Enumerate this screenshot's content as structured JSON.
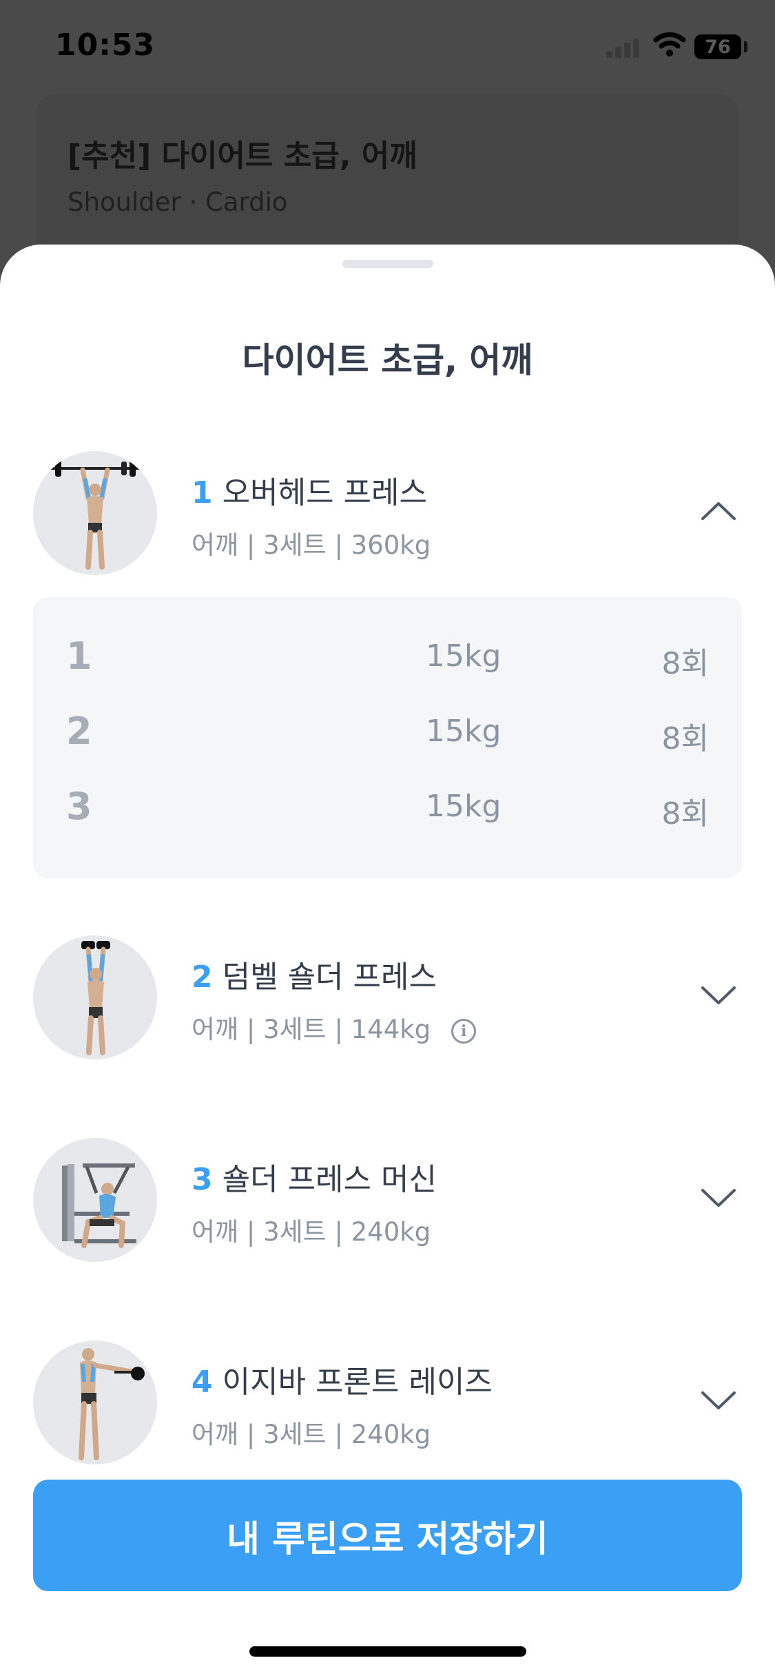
{
  "status_bar": {
    "time": "10:53",
    "battery": "76"
  },
  "background_card": {
    "title": "[추천] 다이어트 초급, 어깨",
    "subtitle": "Shoulder · Cardio"
  },
  "sheet": {
    "title": "다이어트 초급, 어깨",
    "exercises": [
      {
        "num": "1",
        "name": "오버헤드 프레스",
        "meta": "어깨 | 3세트 | 360kg",
        "expanded": true,
        "thumbnail": "overhead-press-figure"
      },
      {
        "num": "2",
        "name": "덤벨 숄더 프레스",
        "meta": "어깨 | 3세트 | 144kg",
        "expanded": false,
        "has_info": true,
        "thumbnail": "dumbbell-shoulder-press-figure"
      },
      {
        "num": "3",
        "name": "숄더 프레스 머신",
        "meta": "어깨 | 3세트 | 240kg",
        "expanded": false,
        "thumbnail": "shoulder-press-machine-figure"
      },
      {
        "num": "4",
        "name": "이지바 프론트 레이즈",
        "meta": "어깨 | 3세트 | 240kg",
        "expanded": false,
        "thumbnail": "ez-bar-front-raise-figure"
      }
    ],
    "sets": [
      {
        "no": "1",
        "weight": "15kg",
        "reps": "8회"
      },
      {
        "no": "2",
        "weight": "15kg",
        "reps": "8회"
      },
      {
        "no": "3",
        "weight": "15kg",
        "reps": "8회"
      }
    ],
    "save_button": "내 루틴으로 저장하기"
  },
  "colors": {
    "accent": "#3ba0f5",
    "title_text": "#333d4b",
    "meta_text": "#8b95a1",
    "set_panel": "#f4f6f8",
    "dim_overlay": "#4a4a4a"
  }
}
